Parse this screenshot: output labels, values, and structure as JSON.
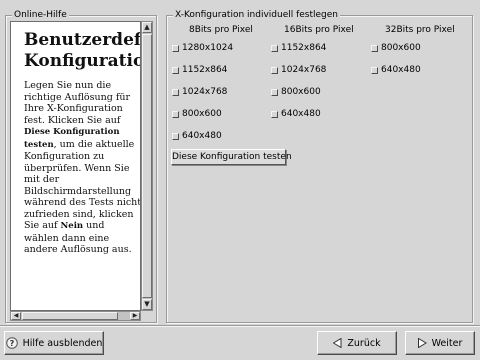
{
  "help_panel": {
    "legend": "Online-Hilfe",
    "title_line1": "Benutzerdefinie",
    "title_line2": "Konfiguration",
    "body_part1": "Legen Sie nun die richtige Auflösung für Ihre X-Konfiguration fest. Klicken Sie auf ",
    "body_bold1": "Diese Konfiguration testen",
    "body_part2": ", um die aktuelle Konfiguration zu überprüfen. Wenn Sie mit der Bildschirmdarstellung während des Tests nicht zufrieden sind, klicken Sie auf ",
    "body_bold2": "Nein",
    "body_part3": " und wählen dann eine andere Auflösung aus."
  },
  "config_panel": {
    "legend": "X-Konfiguration individuell festlegen",
    "columns": [
      {
        "header": "8Bits pro Pixel",
        "options": [
          "1280x1024",
          "1152x864",
          "1024x768",
          "800x600",
          "640x480"
        ]
      },
      {
        "header": "16Bits pro Pixel",
        "options": [
          "1152x864",
          "1024x768",
          "800x600",
          "640x480"
        ]
      },
      {
        "header": "32Bits pro Pixel",
        "options": [
          "800x600",
          "640x480"
        ]
      }
    ],
    "test_button": "Diese Konfiguration testen"
  },
  "footer": {
    "help_toggle": "Hilfe ausblenden",
    "back": "Zurück",
    "next": "Weiter"
  },
  "icons": {
    "help": "question-mark-icon",
    "back": "left-triangle-icon",
    "next": "right-triangle-icon"
  }
}
